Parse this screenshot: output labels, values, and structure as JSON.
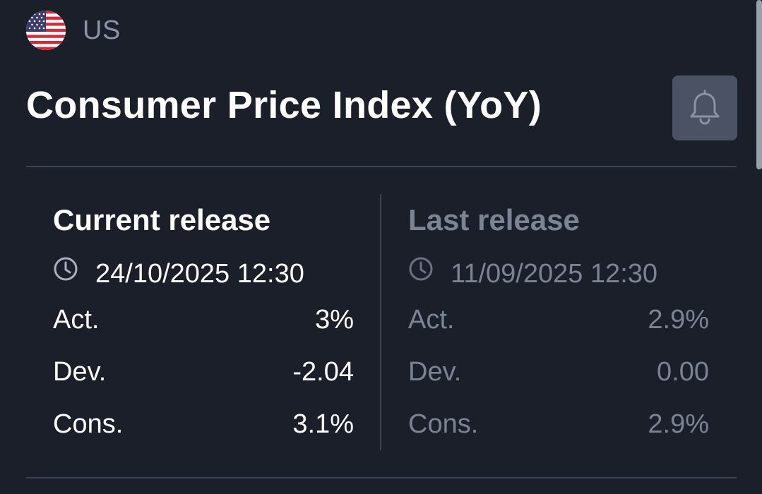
{
  "country": {
    "name": "US",
    "flag_icon": "us-flag-icon"
  },
  "event": {
    "title": "Consumer Price Index (YoY)",
    "alert_icon": "bell-icon"
  },
  "current_release": {
    "heading": "Current release",
    "datetime": "24/10/2025 12:30",
    "rows": [
      {
        "label": "Act.",
        "value": "3%"
      },
      {
        "label": "Dev.",
        "value": "-2.04"
      },
      {
        "label": "Cons.",
        "value": "3.1%"
      }
    ]
  },
  "last_release": {
    "heading": "Last release",
    "datetime": "11/09/2025 12:30",
    "rows": [
      {
        "label": "Act.",
        "value": "2.9%"
      },
      {
        "label": "Dev.",
        "value": "0.00"
      },
      {
        "label": "Cons.",
        "value": "2.9%"
      }
    ]
  },
  "colors": {
    "background": "#1b1f2a",
    "primary_text": "#ffffff",
    "muted_text": "#7c8393",
    "button_bg": "#4a5263",
    "divider": "#3c4352"
  }
}
